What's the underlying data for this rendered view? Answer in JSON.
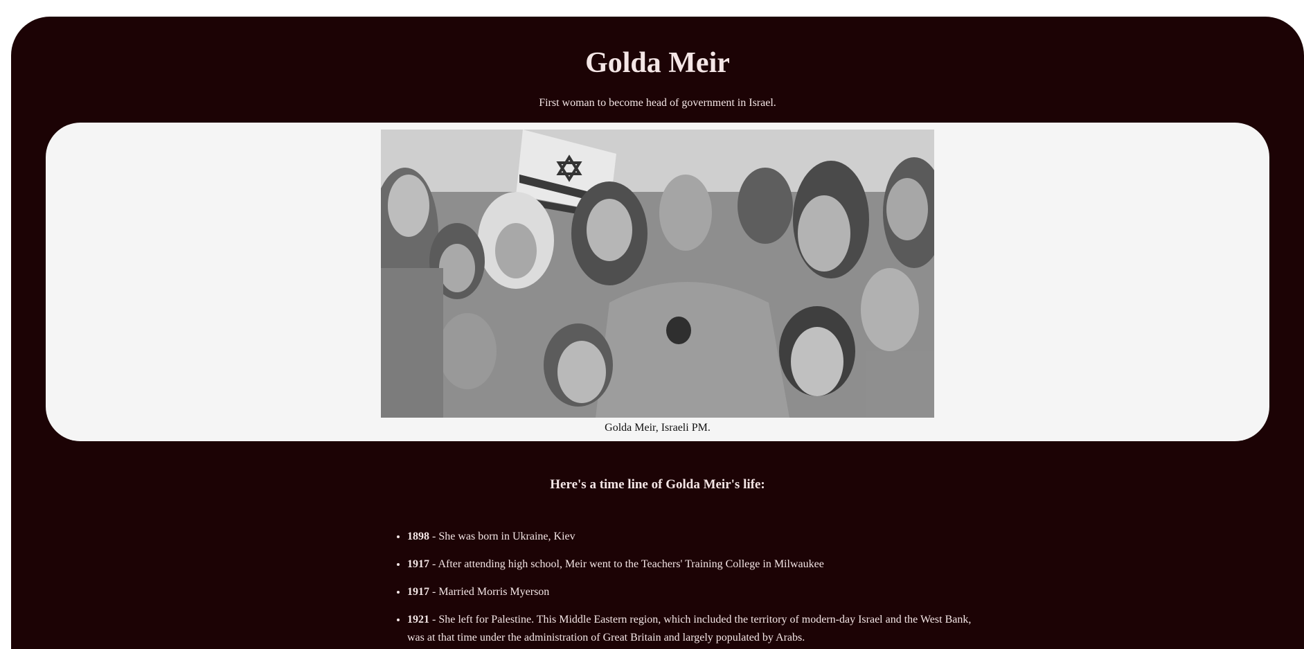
{
  "page": {
    "title": "Golda Meir",
    "subtitle": "First woman to become head of government in Israel."
  },
  "image": {
    "caption": "Golda Meir, Israeli PM."
  },
  "timeline": {
    "heading": "Here's a time line of Golda Meir's life:",
    "items": [
      {
        "year": "1898",
        "text": " - She was born in Ukraine, Kiev"
      },
      {
        "year": "1917",
        "text": " - After attending high school, Meir went to the Teachers' Training College in Milwaukee"
      },
      {
        "year": "1917",
        "text": " - Married Morris Myerson"
      },
      {
        "year": "1921",
        "text": " - She left for Palestine. This Middle Eastern region, which included the territory of modern-day Israel and the West Bank, was at that time under the administration of Great Britain and largely populated by Arabs."
      }
    ]
  },
  "colors": {
    "background": "#1c0305",
    "text": "#f4e6e6",
    "image_panel": "#f5f5f5"
  }
}
